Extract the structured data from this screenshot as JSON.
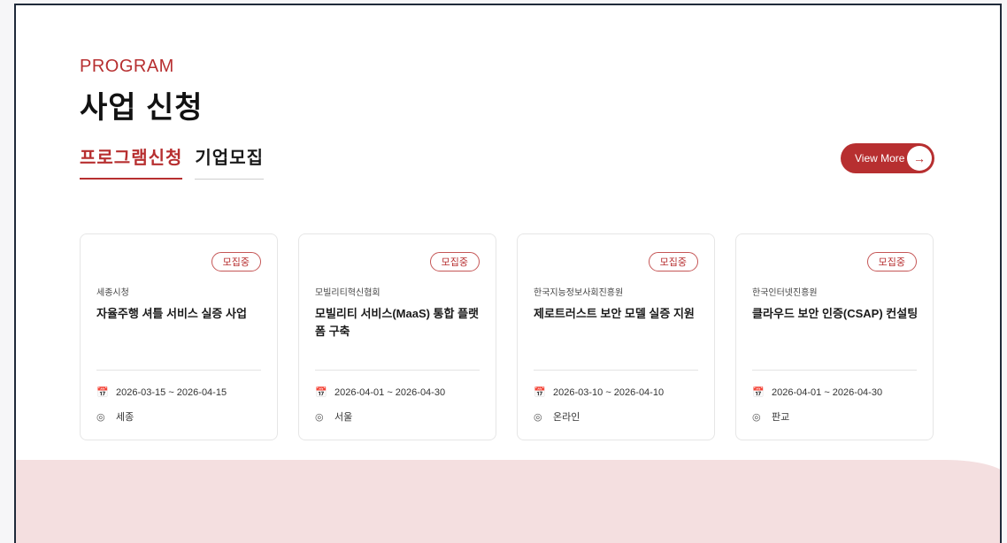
{
  "section": {
    "eyebrow": "PROGRAM",
    "title": "사업 신청"
  },
  "tabs": [
    {
      "label": "프로그램신청",
      "active": true
    },
    {
      "label": "기업모집",
      "active": false
    }
  ],
  "view_more": {
    "label": "View More",
    "icon": "arrow-right-icon"
  },
  "cards": [
    {
      "badge": "모집중",
      "org": "세종시청",
      "title": "자율주행 셔틀 서비스 실증 사업",
      "date": "2026-03-15 ~ 2026-04-15",
      "location": "세종"
    },
    {
      "badge": "모집중",
      "org": "모빌리티혁신협회",
      "title": "모빌리티 서비스(MaaS) 통합 플랫폼 구축",
      "date": "2026-04-01 ~ 2026-04-30",
      "location": "서울"
    },
    {
      "badge": "모집중",
      "org": "한국지능정보사회진흥원",
      "title": "제로트러스트 보안 모델 실증 지원",
      "date": "2026-03-10 ~ 2026-04-10",
      "location": "온라인"
    },
    {
      "badge": "모집중",
      "org": "한국인터넷진흥원",
      "title": "클라우드 보안 인증(CSAP) 컨설팅",
      "date": "2026-04-01 ~ 2026-04-30",
      "location": "판교"
    }
  ],
  "colors": {
    "accent": "#b72f30",
    "band": "#f4dfe0"
  },
  "icons": {
    "date": "calendar-icon",
    "location": "location-pin-icon"
  }
}
